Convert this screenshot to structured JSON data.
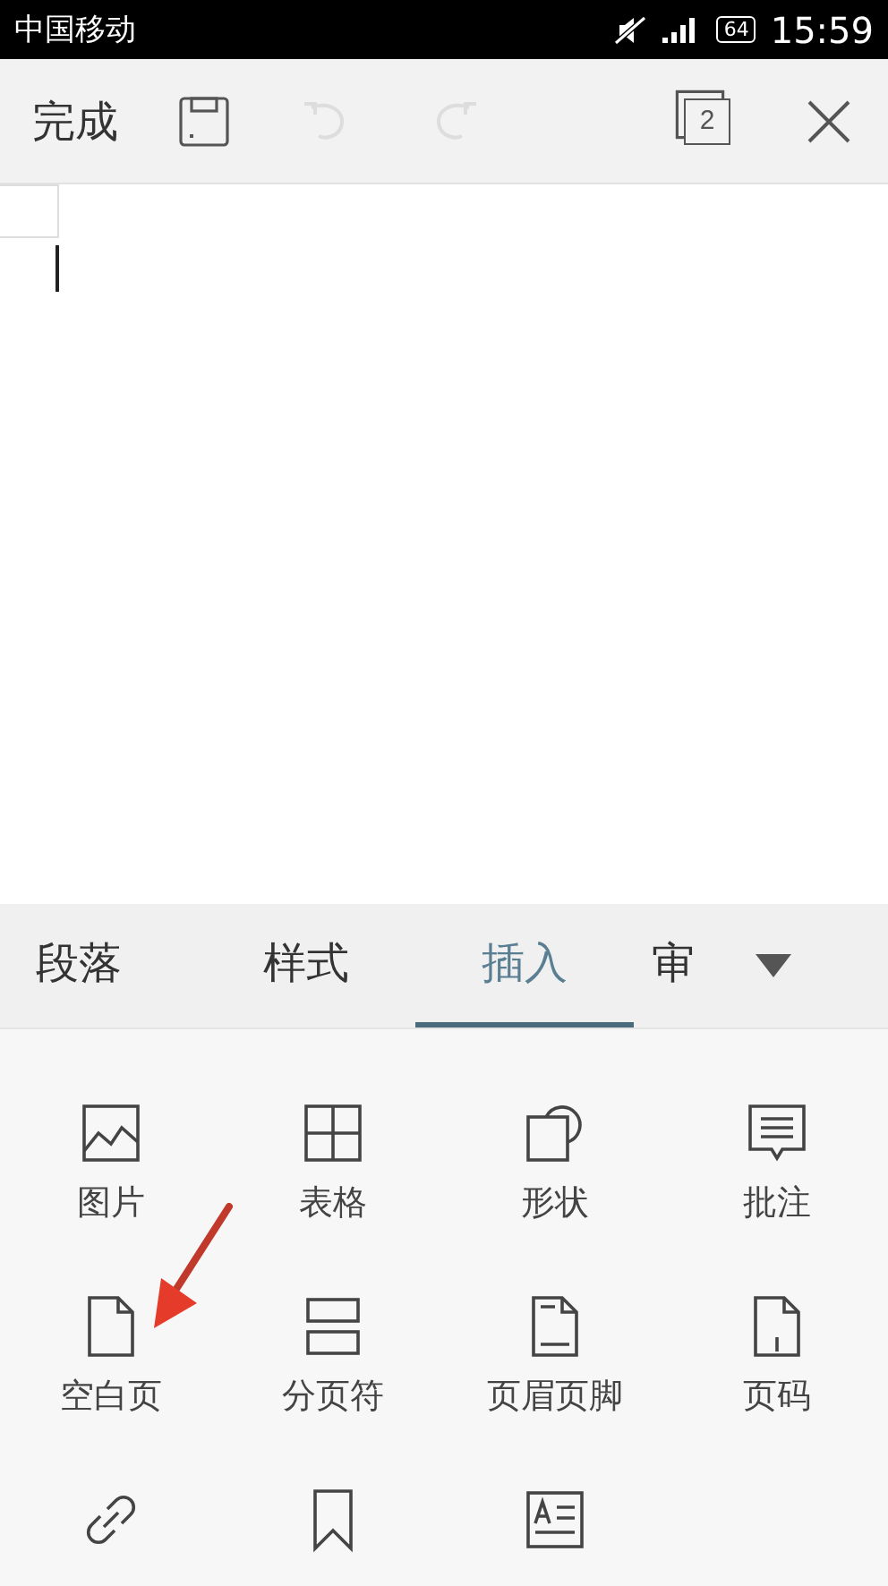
{
  "status_bar": {
    "carrier": "中国移动",
    "battery": "64",
    "time": "15:59"
  },
  "toolbar": {
    "done": "完成",
    "undo_enabled": false,
    "redo_enabled": false,
    "page_count": "2"
  },
  "tabs": [
    {
      "label": "段落",
      "selected": false
    },
    {
      "label": "样式",
      "selected": false
    },
    {
      "label": "插入",
      "selected": true
    },
    {
      "label": "审",
      "selected": false
    }
  ],
  "insert_items": [
    {
      "label": "图片",
      "kind": "picture"
    },
    {
      "label": "表格",
      "kind": "table"
    },
    {
      "label": "形状",
      "kind": "shape"
    },
    {
      "label": "批注",
      "kind": "comment"
    },
    {
      "label": "空白页",
      "kind": "blank-page"
    },
    {
      "label": "分页符",
      "kind": "page-break"
    },
    {
      "label": "页眉页脚",
      "kind": "header-footer"
    },
    {
      "label": "页码",
      "kind": "page-number"
    },
    {
      "kind": "link"
    },
    {
      "kind": "bookmark"
    },
    {
      "kind": "textbox"
    }
  ]
}
